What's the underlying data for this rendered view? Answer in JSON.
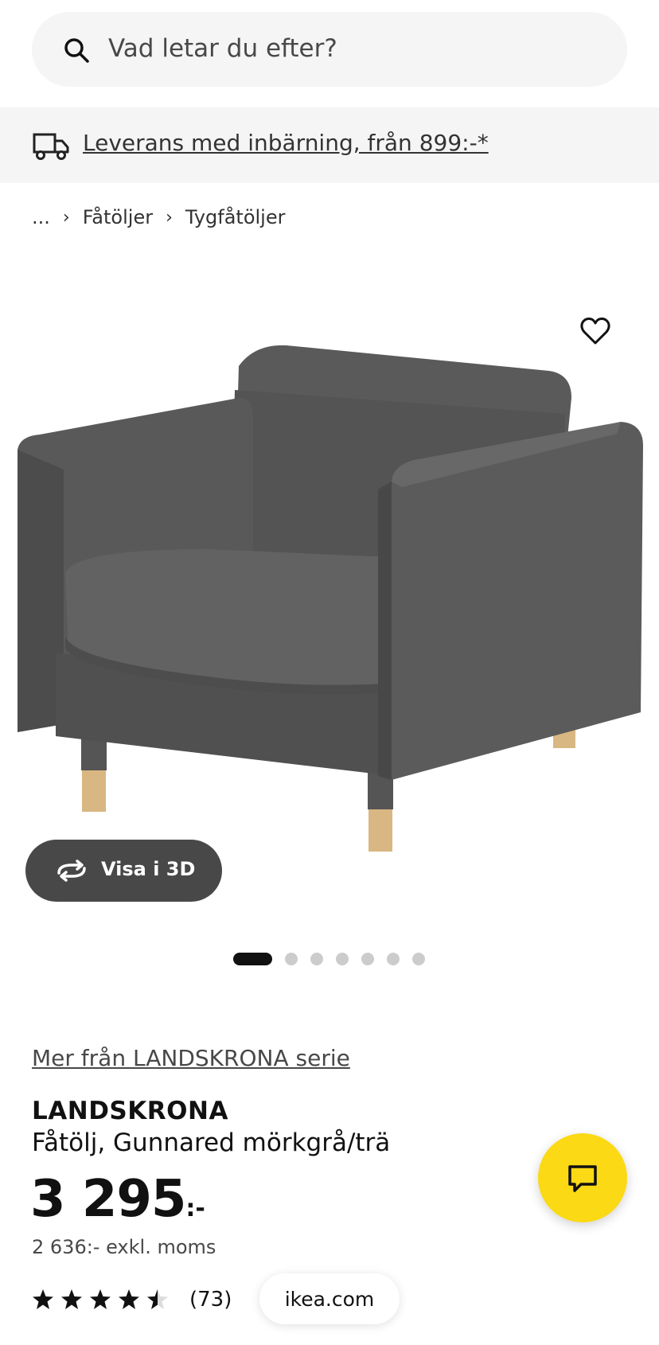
{
  "search": {
    "placeholder": "Vad letar du efter?"
  },
  "delivery": {
    "text": "Leverans med inbärning, från 899:-*"
  },
  "breadcrumb": {
    "ellipsis": "...",
    "items": [
      "Fåtöljer",
      "Tygfåtöljer"
    ]
  },
  "gallery": {
    "view_3d_label": "Visa i 3D",
    "dot_count": 7,
    "active_index": 0
  },
  "product": {
    "series_link": "Mer från LANDSKRONA serie",
    "name": "LANDSKRONA",
    "description": "Fåtölj, Gunnared mörkgrå/trä",
    "price_main": "3 295",
    "price_suffix": ":-",
    "price_ex_vat": "2 636:- exkl. moms",
    "rating": 4.5,
    "rating_max": 5,
    "review_count": "(73)"
  },
  "browser": {
    "domain": "ikea.com"
  },
  "colors": {
    "accent_yellow": "#fbd914",
    "button_dark": "#484848",
    "banner_bg": "#f5f5f5"
  },
  "icons": {
    "search": "search-icon",
    "truck": "truck-icon",
    "favorite": "heart-icon",
    "rotate": "rotate-icon",
    "chat": "chat-icon",
    "star": "star-icon"
  }
}
